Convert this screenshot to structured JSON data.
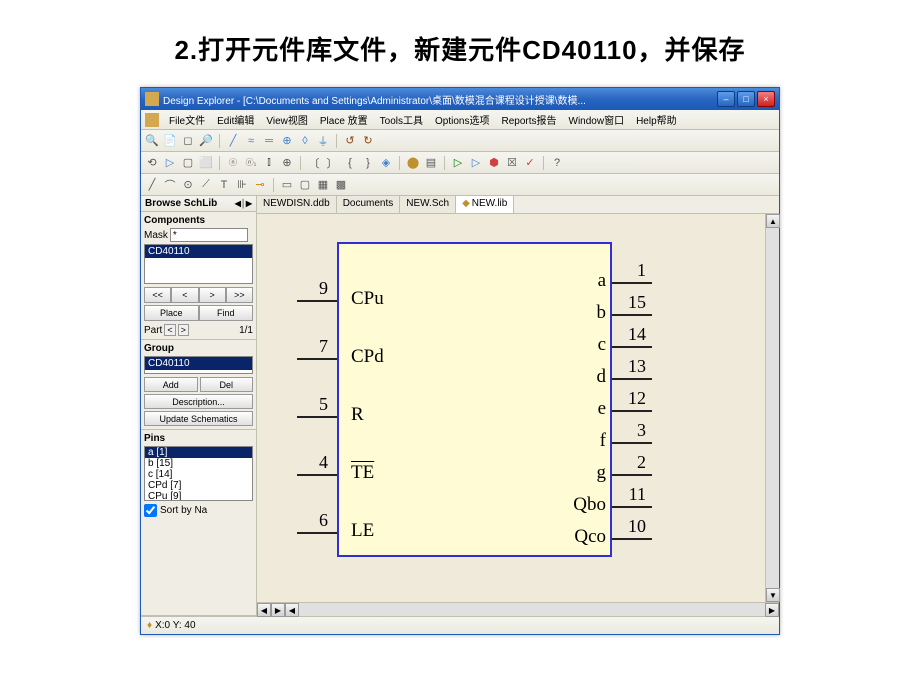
{
  "slide_title": "2.打开元件库文件，新建元件CD40110，并保存",
  "window_title": "Design Explorer - [C:\\Documents and Settings\\Administrator\\桌面\\数模混合课程设计授课\\数模...",
  "menus": [
    "File文件",
    "Edit编辑",
    "View视图",
    "Place 放置",
    "Tools工具",
    "Options选项",
    "Reports报告",
    "Window窗口",
    "Help帮助"
  ],
  "browse_tab": "Browse SchLib",
  "components_label": "Components",
  "mask_label": "Mask",
  "mask_value": "*",
  "component_selected": "CD40110",
  "nav_prev2": "<<",
  "nav_prev": "<",
  "nav_next": ">",
  "nav_next2": ">>",
  "place_btn": "Place",
  "find_btn": "Find",
  "part_label": "Part",
  "part_nav_lt": "<",
  "part_nav_gt": ">",
  "part_count": "1/1",
  "group_label": "Group",
  "group_selected": "CD40110",
  "add_btn": "Add",
  "del_btn": "Del",
  "desc_btn": "Description...",
  "update_btn": "Update Schematics",
  "pins_label": "Pins",
  "pins_list": [
    "a  [1]",
    "b  [15]",
    "c  [14]",
    "CPd  [7]",
    "CPu  [9]"
  ],
  "sort_label": "Sort by Na",
  "doc_tabs": [
    "NEWDISN.ddb",
    "Documents",
    "NEW.Sch",
    "NEW.lib"
  ],
  "left_pins": [
    {
      "num": "9",
      "name": "CPu"
    },
    {
      "num": "7",
      "name": "CPd"
    },
    {
      "num": "5",
      "name": "R"
    },
    {
      "num": "4",
      "name": "TE",
      "overline": true
    },
    {
      "num": "6",
      "name": "LE"
    }
  ],
  "right_pins": [
    {
      "num": "1",
      "name": "a"
    },
    {
      "num": "15",
      "name": "b"
    },
    {
      "num": "14",
      "name": "c"
    },
    {
      "num": "13",
      "name": "d"
    },
    {
      "num": "12",
      "name": "e"
    },
    {
      "num": "3",
      "name": "f"
    },
    {
      "num": "2",
      "name": "g"
    },
    {
      "num": "11",
      "name": "Qbo"
    },
    {
      "num": "10",
      "name": "Qco"
    }
  ],
  "status_text": "X:0 Y: 40"
}
